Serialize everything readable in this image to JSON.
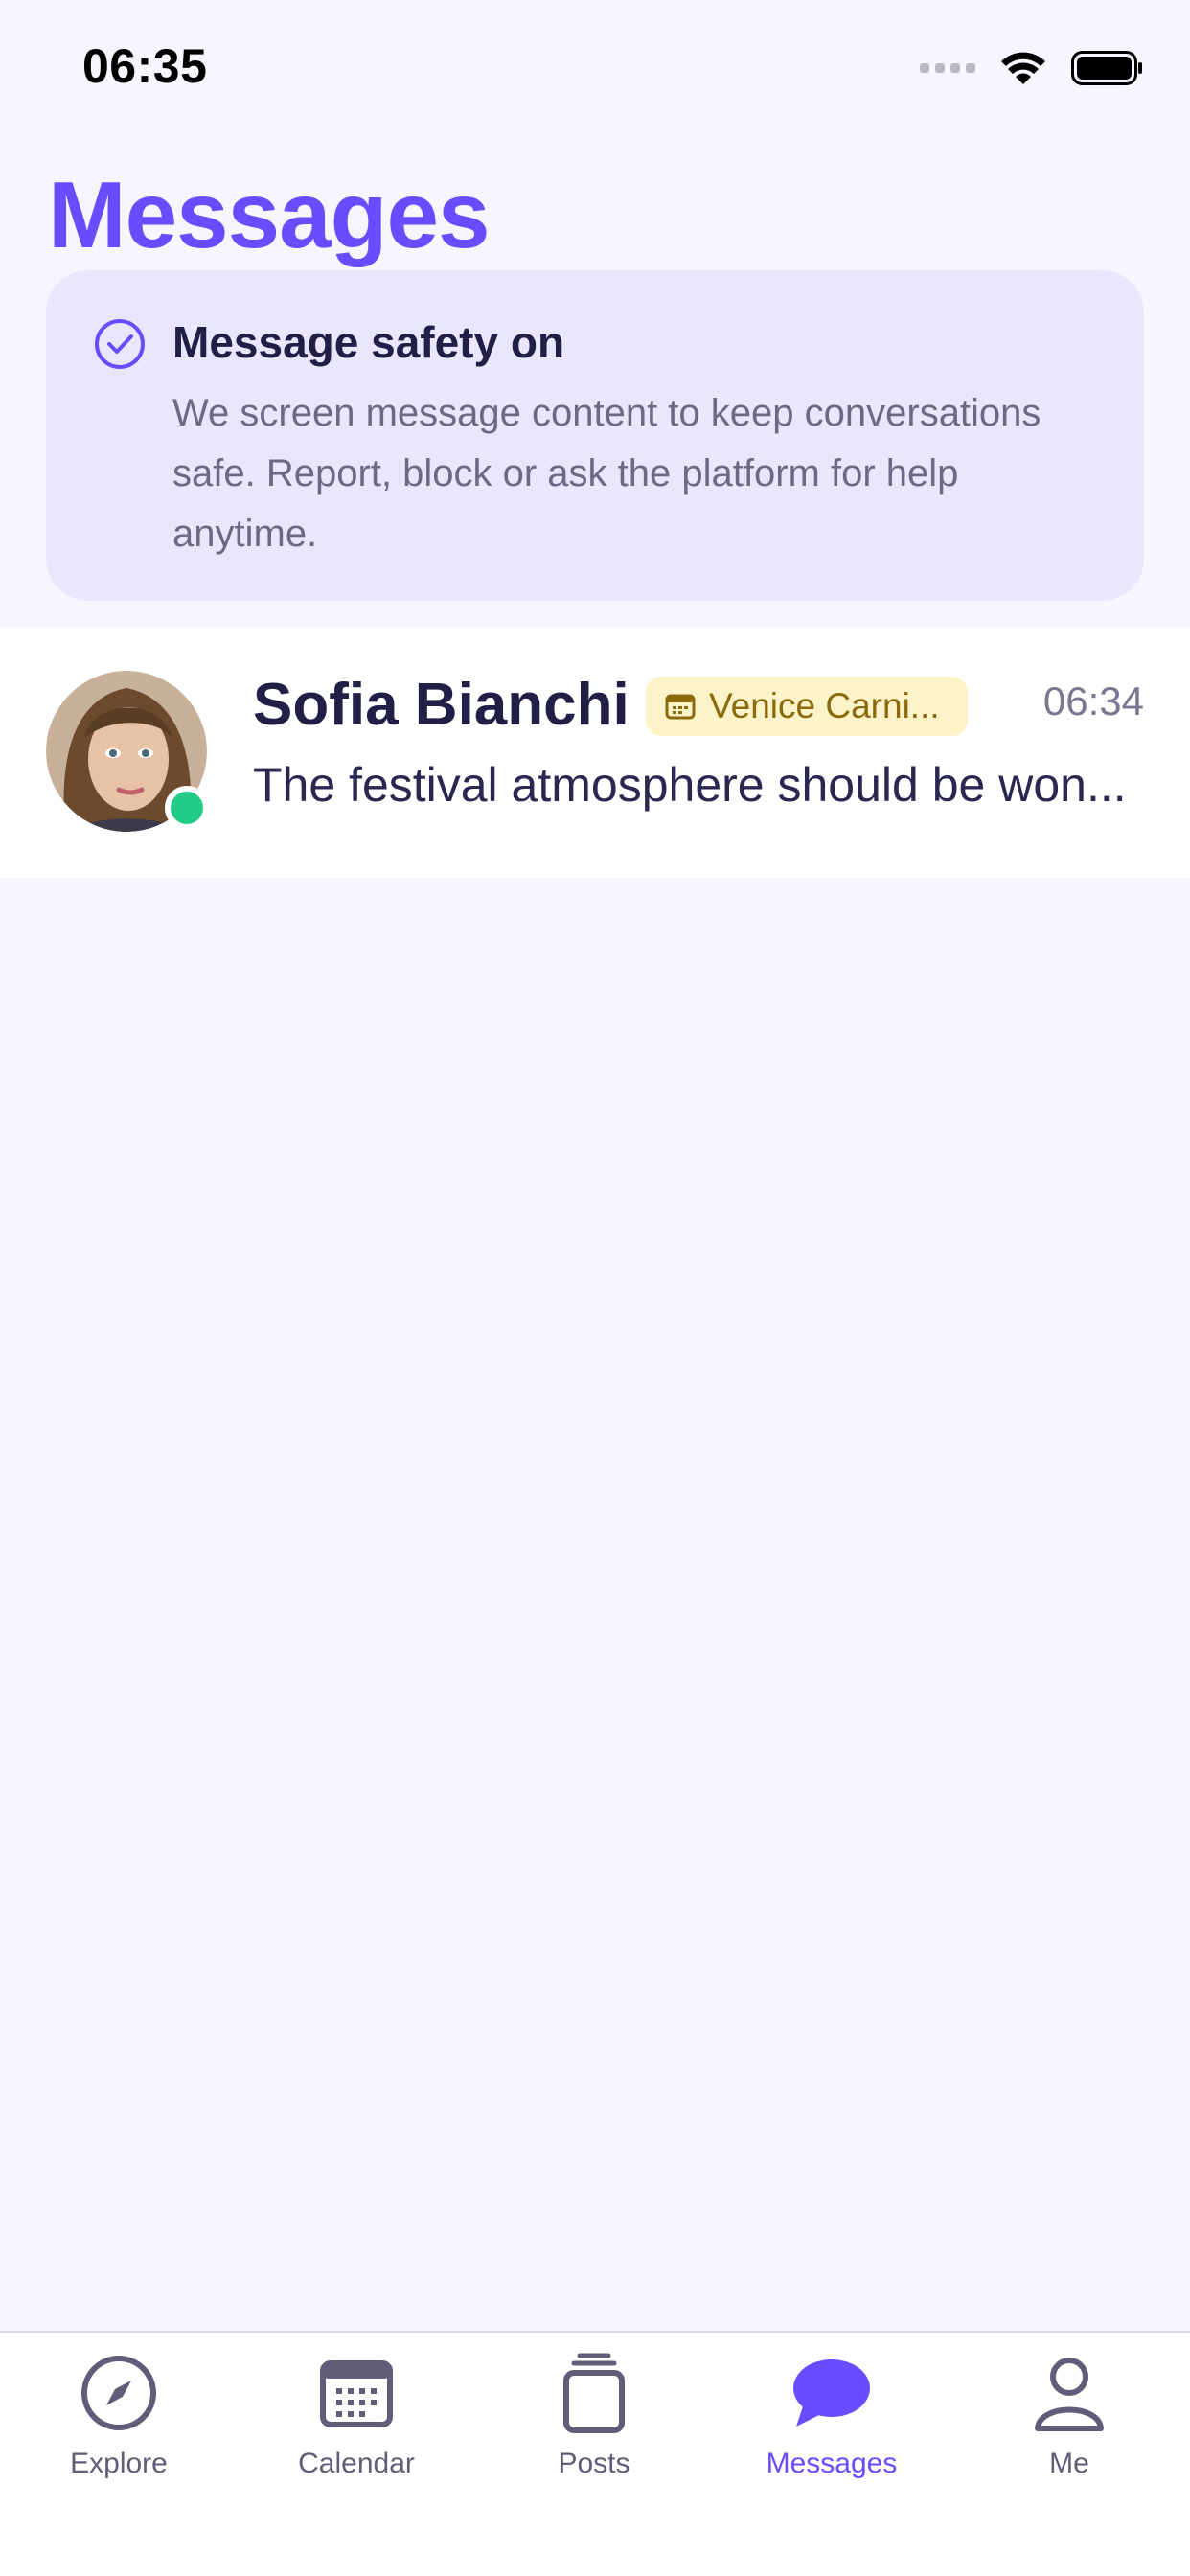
{
  "status_bar": {
    "time": "06:35"
  },
  "page": {
    "title": "Messages"
  },
  "safety_notice": {
    "title": "Message safety on",
    "body": "We screen message content to keep conversations safe. Report, block or ask the platform for help anytime.",
    "icon": "check-circle-icon"
  },
  "conversations": [
    {
      "name": "Sofia Bianchi",
      "event_tag": "Venice Carni...",
      "time": "06:34",
      "preview": "The festival atmosphere should be won...",
      "online": true
    }
  ],
  "tab_bar": {
    "tabs": [
      {
        "label": "Explore",
        "icon": "compass-icon",
        "active": false
      },
      {
        "label": "Calendar",
        "icon": "calendar-icon",
        "active": false
      },
      {
        "label": "Posts",
        "icon": "posts-icon",
        "active": false
      },
      {
        "label": "Messages",
        "icon": "chat-bubble-icon",
        "active": true
      },
      {
        "label": "Me",
        "icon": "person-icon",
        "active": false
      }
    ]
  },
  "colors": {
    "accent": "#6a4cff",
    "background": "#f6f6ff",
    "safety_card": "#e9e7fe",
    "event_tag_bg": "#fdf3c9",
    "event_tag_text": "#8a6a0b",
    "online": "#22cc88"
  }
}
